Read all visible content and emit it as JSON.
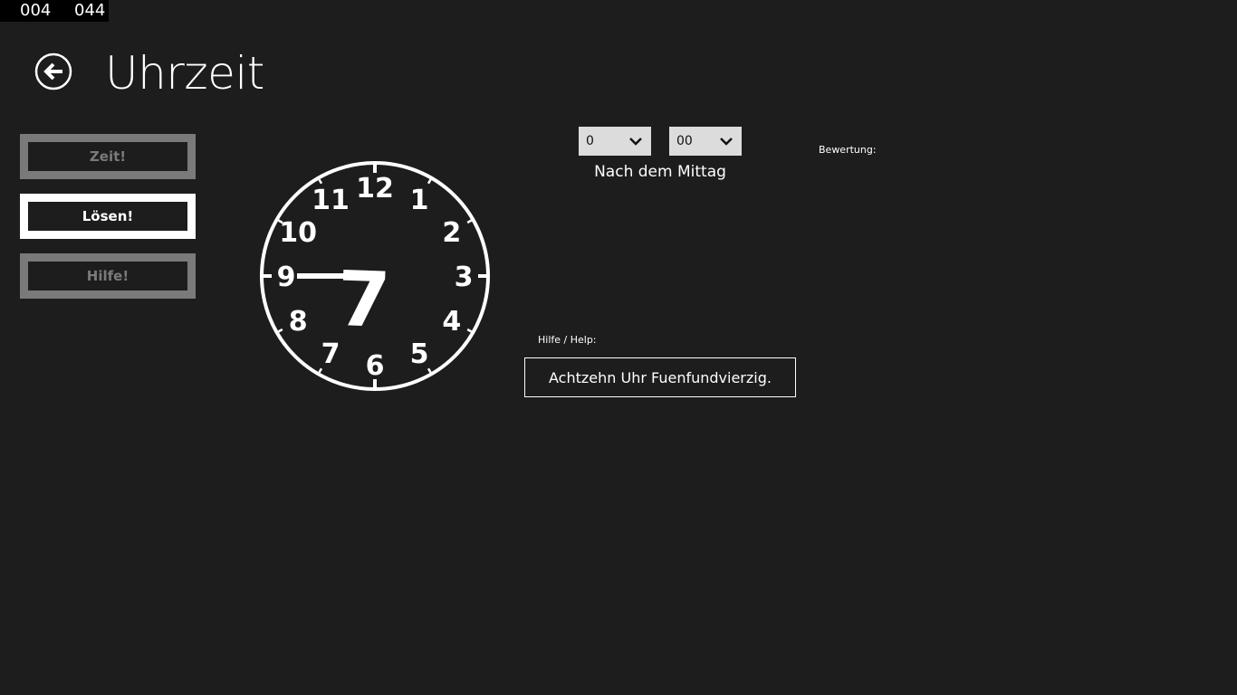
{
  "counter": {
    "left": "004",
    "right": "044"
  },
  "header": {
    "title": "Uhrzeit",
    "back_icon": "arrow-left-circle-icon"
  },
  "sidebar": {
    "buttons": [
      {
        "label": "Zeit!",
        "state": "inactive"
      },
      {
        "label": "Lösen!",
        "state": "active"
      },
      {
        "label": "Hilfe!",
        "state": "inactive"
      }
    ]
  },
  "clock": {
    "numerals": [
      "12",
      "1",
      "2",
      "3",
      "4",
      "5",
      "6",
      "7",
      "8",
      "9",
      "10",
      "11"
    ],
    "hour_hand_points_to": 9,
    "minute_hand_points_to_numeral": 7,
    "minute_hand_glyph": "7"
  },
  "time_select": {
    "hours_value": "0",
    "minutes_value": "00",
    "period_label": "Nach dem Mittag"
  },
  "rating": {
    "label": "Bewertung:"
  },
  "help": {
    "label": "Hilfe / Help:",
    "text": "Achtzehn Uhr Fuenfundvierzig."
  },
  "colors": {
    "background": "#1d1d1d",
    "foreground": "#ffffff",
    "inactive": "#7a7a7a",
    "select_bg": "#dcdcdc"
  }
}
